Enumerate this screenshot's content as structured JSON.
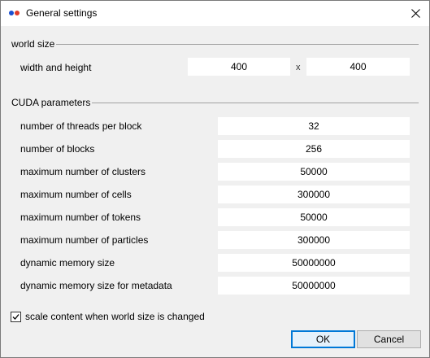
{
  "window": {
    "title": "General settings",
    "close_icon": "close-icon",
    "app_icon": "app-logo-icon"
  },
  "world_size": {
    "section_title": "world size",
    "label": "width and height",
    "width": "400",
    "separator": "x",
    "height": "400"
  },
  "cuda": {
    "section_title": "CUDA parameters",
    "rows": [
      {
        "label": "number of threads per block",
        "value": "32"
      },
      {
        "label": "number of blocks",
        "value": "256"
      },
      {
        "label": "maximum number of clusters",
        "value": "50000"
      },
      {
        "label": "maximum number of cells",
        "value": "300000"
      },
      {
        "label": "maximum number of tokens",
        "value": "50000"
      },
      {
        "label": "maximum number of particles",
        "value": "300000"
      },
      {
        "label": "dynamic memory size",
        "value": "50000000"
      },
      {
        "label": "dynamic memory size for metadata",
        "value": "50000000"
      }
    ]
  },
  "scale_option": {
    "label": "scale content when world size is changed",
    "checked": true
  },
  "buttons": {
    "ok": "OK",
    "cancel": "Cancel"
  },
  "colors": {
    "accent": "#0078d7",
    "field_bg": "#ffffff",
    "dialog_bg": "#f0f0f0"
  }
}
